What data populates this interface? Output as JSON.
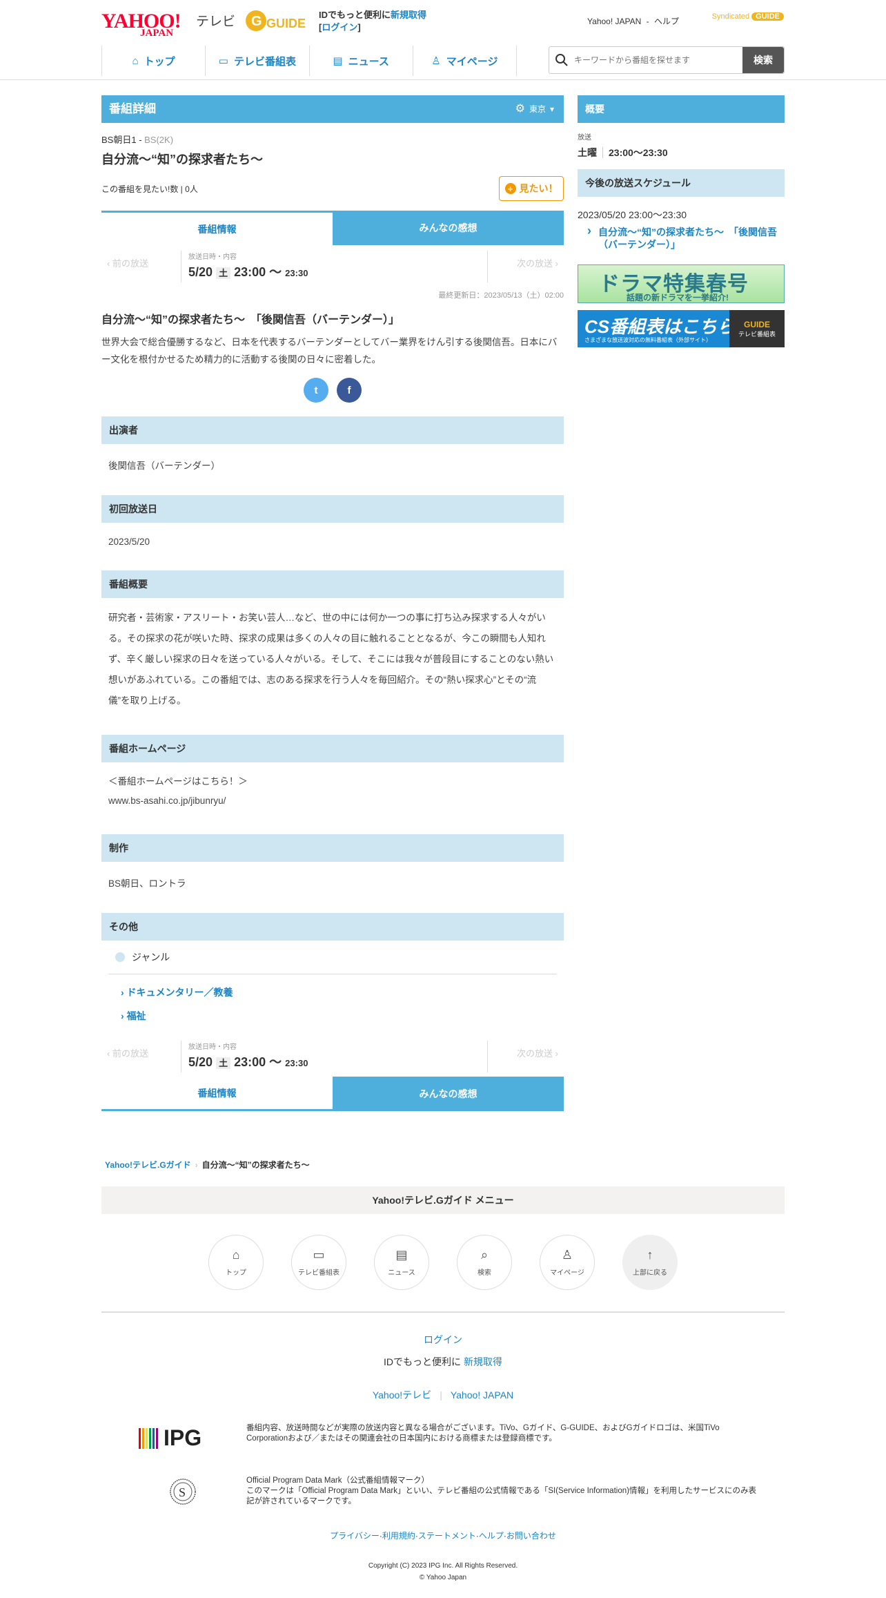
{
  "header": {
    "logo_yahoo": "YAHOO!",
    "logo_japan": "JAPAN",
    "logo_tv": "テレビ",
    "gguide_logo": "G GUIDE",
    "id_prefix": "IDでもっと便利に",
    "id_register": "新規取得",
    "id_login": "ログイン",
    "yahoo_japan_link": "Yahoo! JAPAN",
    "help_link": "ヘルプ",
    "syndicated": "Syndicated"
  },
  "nav": {
    "items": [
      {
        "label": "トップ",
        "icon": "home-icon"
      },
      {
        "label": "テレビ番組表",
        "icon": "tv-icon"
      },
      {
        "label": "ニュース",
        "icon": "news-icon"
      },
      {
        "label": "マイページ",
        "icon": "user-icon"
      }
    ],
    "search_placeholder": "キーワードから番組を探せます",
    "search_button": "検索"
  },
  "main": {
    "section_title": "番組詳細",
    "location": "東京",
    "channel": "BS朝日1",
    "channel_sub": "BS(2K)",
    "program_title": "自分流〜“知”の探求者たち〜",
    "want_label": "この番組を見たい!数",
    "want_count": "0人",
    "want_button": "見たい！",
    "tabs": [
      "番組情報",
      "みんなの感想"
    ],
    "prev_label": "前の放送",
    "next_label": "次の放送",
    "broadcast_label": "放送日時・内容",
    "date": "5/20",
    "dow": "土",
    "start": "23:00",
    "tilde": "〜",
    "end": "23:30",
    "updated": "最終更新日：2023/05/13（土）02:00",
    "episode_title": "自分流〜“知”の探求者たち〜　「後関信吾（バーテンダー）」",
    "episode_desc": "世界大会で総合優勝するなど、日本を代表するバーテンダーとしてバー業界をけん引する後関信吾。日本にバー文化を根付かせるため精力的に活動する後関の日々に密着した。",
    "cast_heading": "出演者",
    "cast": "後関信吾（バーテンダー）",
    "first_heading": "初回放送日",
    "first_date": "2023/5/20",
    "summary_heading": "番組概要",
    "summary": "研究者・芸術家・アスリート・お笑い芸人…など、世の中には何か一つの事に打ち込み探求する人々がいる。その探求の花が咲いた時、探求の成果は多くの人々の目に触れることとなるが、今この瞬間も人知れず、辛く厳しい探求の日々を送っている人々がいる。そして、そこには我々が普段目にすることのない熱い想いがあふれている。この番組では、志のある探求を行う人々を毎回紹介。その“熱い探求心”とその“流儀”を取り上げる。",
    "homepage_heading": "番組ホームページ",
    "homepage_text": "＜番組ホームページはこちら！＞",
    "homepage_url": "www.bs-asahi.co.jp/jibunryu/",
    "production_heading": "制作",
    "production": "BS朝日、ロントラ",
    "other_heading": "その他",
    "genre_label": "ジャンル",
    "genres": [
      "ドキュメンタリー／教養",
      "福祉"
    ]
  },
  "side": {
    "overview": "概要",
    "broadcast_label": "放送",
    "day": "土曜",
    "time": "23:00～23:30",
    "schedule_heading": "今後の放送スケジュール",
    "schedule_date": "2023/05/20 23:00～23:30",
    "schedule_title": "自分流〜“知”の探求者たち〜　「後関信吾（バーテンダー）」",
    "banner1_text": "ドラマ特集春号",
    "banner1_sub": "話題の新ドラマを一挙紹介!",
    "banner2_text": "CS番組表はこちら",
    "banner2_sub": "さまざまな放送波対応の無料番組表（外部サイト）",
    "banner2_badge": "テレビ番組表"
  },
  "footer": {
    "crumb_home": "Yahoo!テレビ.Gガイド",
    "crumb_current": "自分流〜“知”の探求者たち〜",
    "menu_title": "Yahoo!テレビ.Gガイド メニュー",
    "menu_items": [
      {
        "label": "トップ",
        "icon": "home-icon"
      },
      {
        "label": "テレビ番組表",
        "icon": "tv-icon"
      },
      {
        "label": "ニュース",
        "icon": "news-icon"
      },
      {
        "label": "検索",
        "icon": "search-icon"
      },
      {
        "label": "マイページ",
        "icon": "user-icon"
      },
      {
        "label": "上部に戻る",
        "icon": "arrow-up-icon"
      }
    ],
    "login": "ログイン",
    "id_text": "IDでもっと便利に",
    "register": "新規取得",
    "yahoo_tv": "Yahoo!テレビ",
    "yahoo_japan": "Yahoo! JAPAN",
    "ipg_logo": "IPG",
    "ipg_text": "番組内容、放送時間などが実際の放送内容と異なる場合がございます。TiVo、Gガイド、G-GUIDE、およびGガイドロゴは、米国TiVo Corporationおよび／またはその関連会社の日本国内における商標または登録商標です。",
    "mark_title": "Official Program Data Mark（公式番組情報マーク）",
    "mark_text": "このマークは「Official Program Data Mark」といい、テレビ番組の公式情報である「SI(Service Information)情報」を利用したサービスにのみ表記が許されているマークです。",
    "links": [
      "プライバシー",
      "利用規約",
      "ステートメント",
      "ヘルプ",
      "お問い合わせ"
    ],
    "copyright1": "Copyright (C) 2023 IPG Inc. All Rights Reserved.",
    "copyright2": "© Yahoo Japan"
  }
}
